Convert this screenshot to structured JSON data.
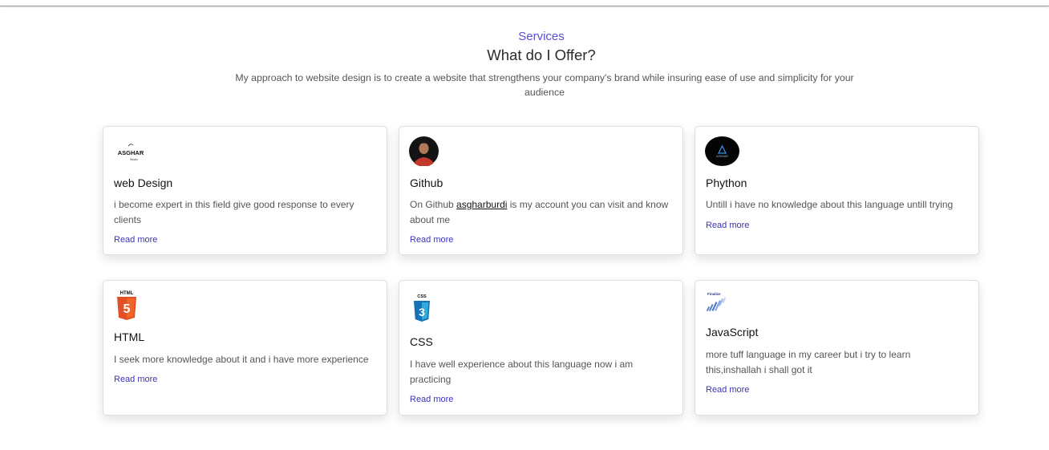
{
  "header": {
    "eyebrow": "Services",
    "title": "What do I Offer?",
    "description": "My approach to website design is to create a website that strengthens your company's brand while insuring ease of use and simplicity for your audience"
  },
  "cards": [
    {
      "icon": "asghar-logo-icon",
      "logo_text": "ASGHAR",
      "logo_subtext": "Studio",
      "title": "web Design",
      "description": "i become expert in this field give good response to every clients",
      "read_more": "Read more"
    },
    {
      "icon": "profile-photo-icon",
      "title": "Github",
      "desc_prefix": "On Github ",
      "desc_link": "asgharburdi",
      "desc_suffix": " is my account you can visit and know about me",
      "read_more": "Read more"
    },
    {
      "icon": "asghar-dark-logo-icon",
      "logo_text": "ASGHAR",
      "title": "Phython",
      "description": "Untill i have no knowledge about this language untill trying",
      "read_more": "Read more"
    },
    {
      "icon": "html5-icon",
      "logo_text": "HTML",
      "logo_number": "5",
      "title": "HTML",
      "description": "I seek more knowledge about it and i have more experience",
      "read_more": "Read more"
    },
    {
      "icon": "css3-icon",
      "logo_text": "CSS",
      "logo_number": "3",
      "title": "CSS",
      "description": "I have well experience about this language now i am practicing",
      "read_more": "Read more"
    },
    {
      "icon": "javascript-chart-icon",
      "logo_text": "Finalize",
      "title": "JavaScript",
      "description": "more tuff language in my career but i try to learn this,inshallah i shall got it",
      "read_more": "Read more"
    }
  ],
  "colors": {
    "accent": "#5a4fcf",
    "link": "#3b33b8",
    "html5": "#e34f26",
    "css3": "#1572b6"
  }
}
